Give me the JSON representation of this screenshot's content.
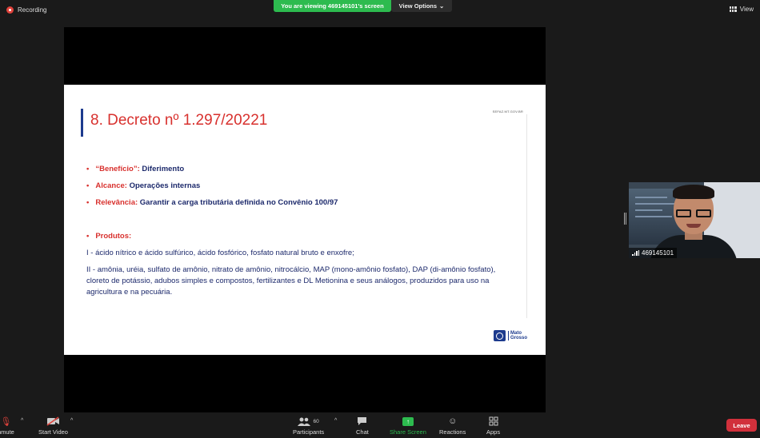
{
  "recording": {
    "label": "Recording"
  },
  "banner": {
    "viewing": "You are viewing 469145101's screen",
    "view_options": "View Options"
  },
  "top_right": {
    "view_label": "View"
  },
  "slide": {
    "title": "8. Decreto nº 1.297/20221",
    "site": "SEFAZ.MT.GOV.BR",
    "bullets": [
      {
        "key": "“Benefício”:",
        "value": "Diferimento"
      },
      {
        "key": "Alcance:",
        "value": "Operações internas"
      },
      {
        "key": "Relevância:",
        "value": "Garantir a carga tributária definida no Convênio 100/97"
      },
      {
        "key": "Produtos:",
        "value": ""
      }
    ],
    "paragraph_1": "I - ácido nítrico e ácido sulfúrico, ácido fosfórico, fosfato natural bruto e enxofre;",
    "paragraph_2": "II - amônia, uréia, sulfato de amônio, nitrato de amônio, nitrocálcio, MAP (mono-amônio fosfato), DAP (di-amônio fosfato), cloreto de potássio, adubos simples e compostos, fertilizantes e DL Metionina e seus análogos, produzidos para uso na agricultura e na pecuária.",
    "logo_top": "Mato",
    "logo_bottom": "Grosso"
  },
  "participant": {
    "name": "469145101"
  },
  "toolbar": {
    "unmute": "nmute",
    "start_video": "Start Video",
    "participants": "Participants",
    "participants_count": "60",
    "chat": "Chat",
    "share_screen": "Share Screen",
    "reactions": "Reactions",
    "apps": "Apps",
    "leave": "Leave"
  },
  "colors": {
    "share_green": "#2dbb4f",
    "leave_red": "#d1303b",
    "title_red": "#d8312e",
    "text_navy": "#1d2a6c"
  }
}
